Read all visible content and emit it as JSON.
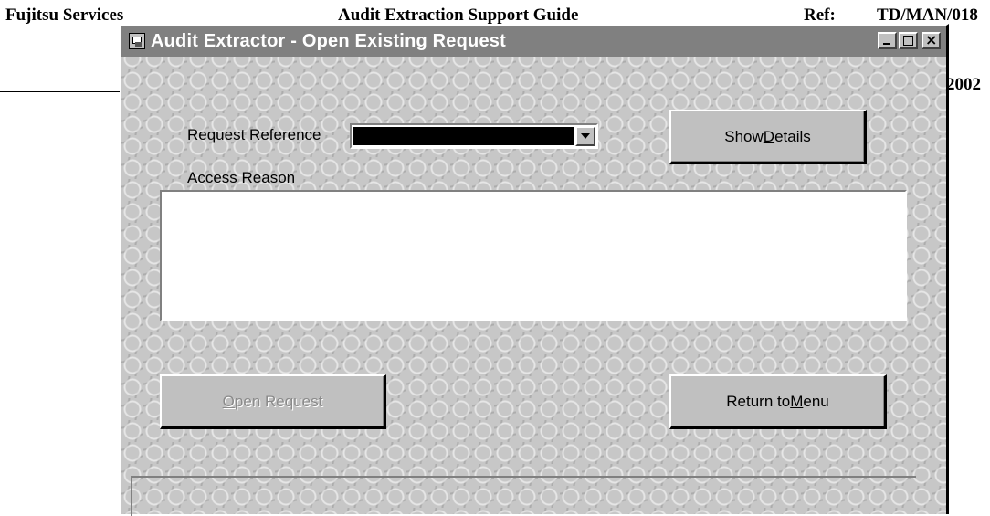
{
  "document": {
    "header_left": "Fujitsu Services",
    "header_center": "Audit Extraction Support Guide",
    "header_ref_label": "Ref:",
    "header_ref_value": "TD/MAN/018",
    "header_date_partial": "2002"
  },
  "window": {
    "title": "Audit Extractor - Open Existing Request",
    "icon": "app-window-icon"
  },
  "form": {
    "request_reference_label": "Request Reference",
    "request_reference_value": "",
    "access_reason_label": "Access Reason",
    "access_reason_value": ""
  },
  "buttons": {
    "show_details": {
      "pre": "Show ",
      "key": "D",
      "post": "etails"
    },
    "open_request": {
      "pre": "",
      "key": "O",
      "post": "pen Request",
      "disabled": true
    },
    "return_to_menu": {
      "pre": "Return to ",
      "key": "M",
      "post": "enu"
    }
  }
}
